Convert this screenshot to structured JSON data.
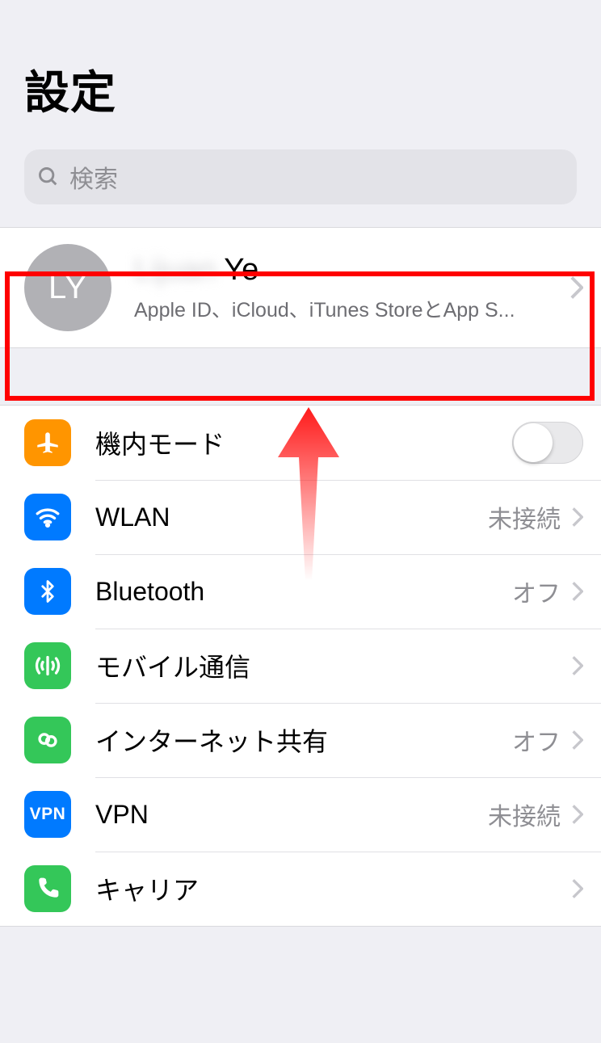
{
  "title": "設定",
  "search": {
    "placeholder": "検索"
  },
  "account": {
    "initials": "LY",
    "name_blurred": "Lijuan",
    "name_visible": " Ye",
    "subtitle": "Apple ID、iCloud、iTunes StoreとApp S..."
  },
  "rows": {
    "airplane": {
      "label": "機内モード"
    },
    "wlan": {
      "label": "WLAN",
      "value": "未接続"
    },
    "bluetooth": {
      "label": "Bluetooth",
      "value": "オフ"
    },
    "cellular": {
      "label": "モバイル通信"
    },
    "hotspot": {
      "label": "インターネット共有",
      "value": "オフ"
    },
    "vpn": {
      "label": "VPN",
      "badge": "VPN",
      "value": "未接続"
    },
    "carrier": {
      "label": "キャリア",
      "value": "　　　　"
    }
  },
  "colors": {
    "orange": "#ff9500",
    "blue": "#007aff",
    "green": "#34c759",
    "grayIcon": "#8e8e93"
  }
}
